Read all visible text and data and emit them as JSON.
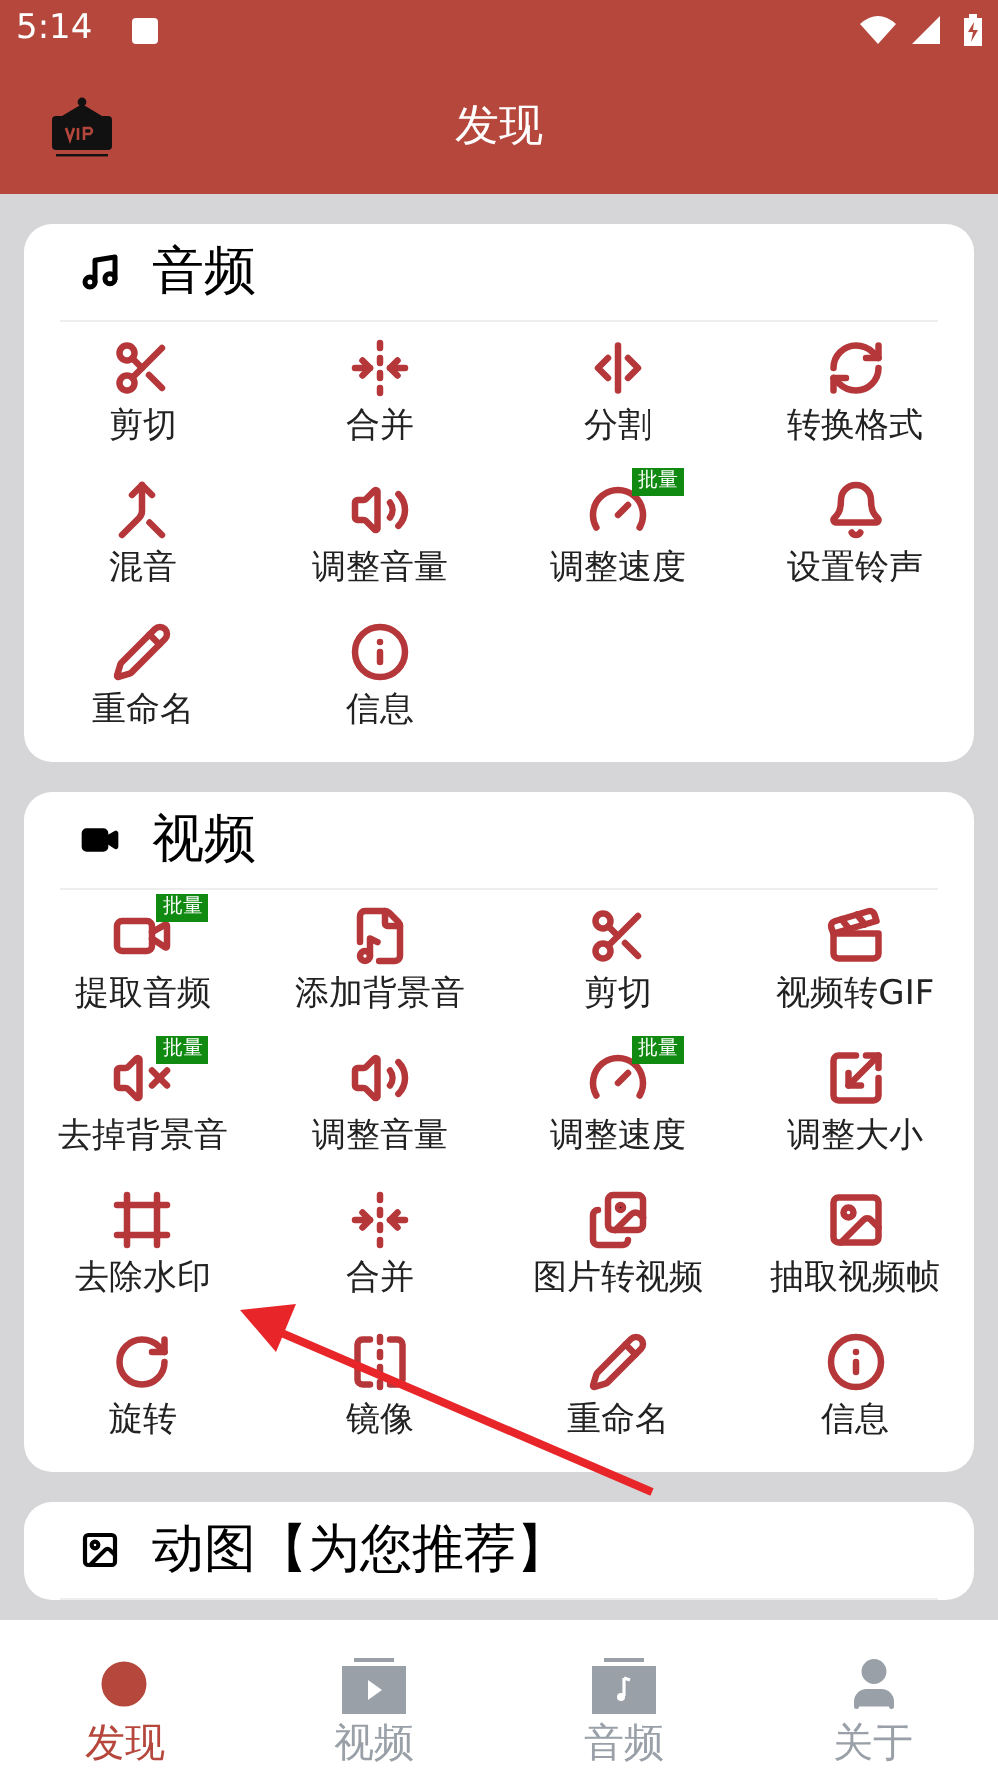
{
  "status_bar": {
    "time": "5:14"
  },
  "header": {
    "title": "发现"
  },
  "sections": [
    {
      "kind": "audio",
      "title": "音频",
      "items": [
        {
          "label": "剪切"
        },
        {
          "label": "合并"
        },
        {
          "label": "分割"
        },
        {
          "label": "转换格式"
        },
        {
          "label": "混音"
        },
        {
          "label": "调整音量"
        },
        {
          "label": "调整速度",
          "badge": "批量"
        },
        {
          "label": "设置铃声"
        },
        {
          "label": "重命名"
        },
        {
          "label": "信息"
        }
      ]
    },
    {
      "kind": "video",
      "title": "视频",
      "items": [
        {
          "label": "提取音频",
          "badge": "批量"
        },
        {
          "label": "添加背景音"
        },
        {
          "label": "剪切"
        },
        {
          "label": "视频转GIF"
        },
        {
          "label": "去掉背景音",
          "badge": "批量"
        },
        {
          "label": "调整音量"
        },
        {
          "label": "调整速度",
          "badge": "批量"
        },
        {
          "label": "调整大小"
        },
        {
          "label": "去除水印"
        },
        {
          "label": "合并"
        },
        {
          "label": "图片转视频"
        },
        {
          "label": "抽取视频帧"
        },
        {
          "label": "旋转"
        },
        {
          "label": "镜像"
        },
        {
          "label": "重命名"
        },
        {
          "label": "信息"
        }
      ]
    },
    {
      "kind": "gif",
      "title": "动图【为您推荐】"
    }
  ],
  "tab_bar": [
    {
      "label": "发现",
      "selected": true
    },
    {
      "label": "视频",
      "selected": false
    },
    {
      "label": "音频",
      "selected": false
    },
    {
      "label": "关于",
      "selected": false
    }
  ]
}
